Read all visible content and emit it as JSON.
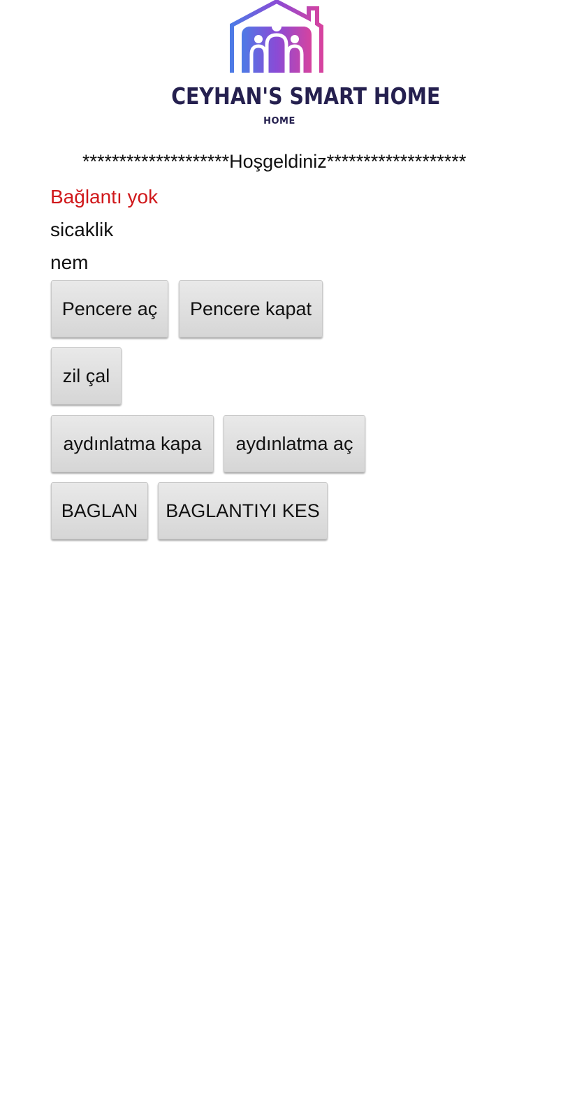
{
  "logo": {
    "title": "CEYHAN'S SMART HOME",
    "subtitle": "HOME"
  },
  "welcome_text": "********************Hoşgeldiniz*******************",
  "connection_status": "Bağlantı yok",
  "temperature_label": "sicaklik",
  "humidity_label": "nem",
  "buttons": {
    "window_open": "Pencere aç",
    "window_close": "Pencere kapat",
    "ring_bell": "zil çal",
    "lights_off": "aydınlatma kapa",
    "lights_on": "aydınlatma aç",
    "connect": "BAGLAN",
    "disconnect": "BAGLANTIYI KES"
  },
  "colors": {
    "status_red": "#d0181b",
    "logo_text": "#25204f",
    "logo_gradient_start": "#4d7be6",
    "logo_gradient_mid": "#8a4bd6",
    "logo_gradient_end": "#d6439f",
    "button_bg": "#dcdcdc"
  }
}
